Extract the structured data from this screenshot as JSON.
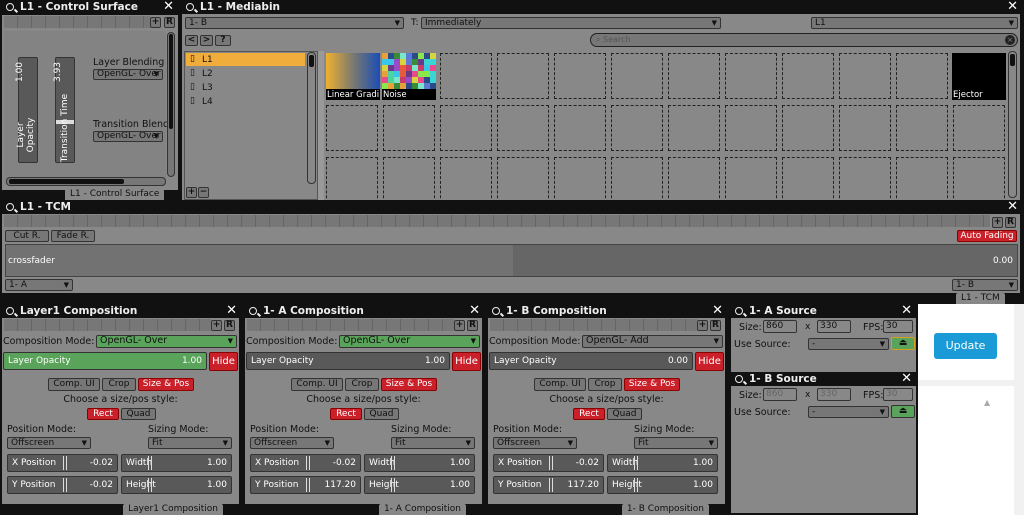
{
  "control_surface": {
    "title": "L1 - Control Surface",
    "footer_tab": "L1 - Control Surface",
    "add_label": "+",
    "reset_label": "R",
    "sliders": [
      {
        "label": "Layer Opacity",
        "value": "1.00"
      },
      {
        "label": "Transition Time",
        "value": "3.93"
      }
    ],
    "layer_blending_label": "Layer Blending",
    "layer_blending_value": "OpenGL- Over",
    "transition_blend_label": "Transition Blend",
    "transition_blend_value": "OpenGL- Over"
  },
  "mediabin": {
    "title": "L1 - Mediabin",
    "deck_select": "1- B",
    "transition_label": "T:",
    "transition_select": "Immediately",
    "layer_select": "L1",
    "search_placeholder": "Search",
    "nav_prev": "<",
    "nav_next": ">",
    "nav_help": "?",
    "layers": [
      "L1",
      "L2",
      "L3",
      "L4"
    ],
    "selected_layer": "L1",
    "add_label": "+",
    "remove_label": "−",
    "clips": [
      {
        "name": "Linear Gradi",
        "type": "gradient"
      },
      {
        "name": "Noise",
        "type": "noise"
      },
      {
        "name": "Ejector",
        "type": "black"
      }
    ]
  },
  "tcm": {
    "title": "L1 - TCM",
    "footer_tab": "L1 - TCM",
    "cut_label": "Cut R.",
    "fade_label": "Fade R.",
    "auto_fading_label": "Auto Fading",
    "crossfader_label": "crossfader",
    "crossfader_value": "0.00",
    "crossfader_fraction": 0.0,
    "left_deck": "1- A",
    "right_deck": "1- B",
    "add_label": "+",
    "reset_label": "R"
  },
  "compositions": [
    {
      "title": "Layer1 Composition",
      "footer_tab": "Layer1 Composition",
      "mode_label": "Composition Mode:",
      "mode_value": "OpenGL- Over",
      "mode_green": true,
      "opacity_label": "Layer Opacity",
      "opacity_value": "1.00",
      "opacity_fraction": 1.0,
      "hide_label": "Hide",
      "tabs": [
        "Comp. UI",
        "Crop",
        "Size & Pos"
      ],
      "style_prompt": "Choose a size/pos style:",
      "style_options": [
        "Rect",
        "Quad"
      ],
      "position_mode_label": "Position Mode:",
      "position_mode_value": "Offscreen",
      "sizing_mode_label": "Sizing Mode:",
      "sizing_mode_value": "Fit",
      "x_label": "X Position",
      "x_value": "-0.02",
      "y_label": "Y Position",
      "y_value": "-0.02",
      "w_label": "Width",
      "w_value": "1.00",
      "h_label": "Height",
      "h_value": "1.00"
    },
    {
      "title": "1- A Composition",
      "footer_tab": "1- A Composition",
      "mode_label": "Composition Mode:",
      "mode_value": "OpenGL- Over",
      "mode_green": true,
      "opacity_label": "Layer Opacity",
      "opacity_value": "1.00",
      "opacity_fraction": 1.0,
      "hide_label": "Hide",
      "tabs": [
        "Comp. UI",
        "Crop",
        "Size & Pos"
      ],
      "style_prompt": "Choose a size/pos style:",
      "style_options": [
        "Rect",
        "Quad"
      ],
      "position_mode_label": "Position Mode:",
      "position_mode_value": "Offscreen",
      "sizing_mode_label": "Sizing Mode:",
      "sizing_mode_value": "Fit",
      "x_label": "X Position",
      "x_value": "-0.02",
      "y_label": "Y Position",
      "y_value": "117.20",
      "w_label": "Width",
      "w_value": "1.00",
      "h_label": "Height",
      "h_value": "1.00"
    },
    {
      "title": "1- B Composition",
      "footer_tab": "1- B Composition",
      "mode_label": "Composition Mode:",
      "mode_value": "OpenGL- Add",
      "mode_green": false,
      "opacity_label": "Layer Opacity",
      "opacity_value": "0.00",
      "opacity_fraction": 0.0,
      "hide_label": "Hide",
      "tabs": [
        "Comp. UI",
        "Crop",
        "Size & Pos"
      ],
      "style_prompt": "Choose a size/pos style:",
      "style_options": [
        "Rect",
        "Quad"
      ],
      "position_mode_label": "Position Mode:",
      "position_mode_value": "Offscreen",
      "sizing_mode_label": "Sizing Mode:",
      "sizing_mode_value": "Fit",
      "x_label": "X Position",
      "x_value": "-0.02",
      "y_label": "Y Position",
      "y_value": "117.20",
      "w_label": "Width",
      "w_value": "1.00",
      "h_label": "Height",
      "h_value": "1.00"
    }
  ],
  "sources": [
    {
      "title": "1- A Source",
      "size_label": "Size:",
      "width": "860",
      "x_label": "x",
      "height": "330",
      "fps_label": "FPS:",
      "fps": "30",
      "use_source_label": "Use Source:",
      "use_source_value": "-",
      "eject_symbol": "⏏",
      "disabled": false
    },
    {
      "title": "1- B Source",
      "size_label": "Size:",
      "width": "860",
      "x_label": "x",
      "height": "330",
      "fps_label": "FPS:",
      "fps": "30",
      "use_source_label": "Use Source:",
      "use_source_value": "-",
      "eject_symbol": "⏏",
      "disabled": true
    }
  ],
  "side": {
    "update_label": "Update",
    "collapse_symbol": "▲"
  },
  "colors": {
    "accent_red": "#c9202a",
    "green": "#5aa35a",
    "selected_orange": "#f0ad3c",
    "update_blue": "#1a9bd7"
  }
}
